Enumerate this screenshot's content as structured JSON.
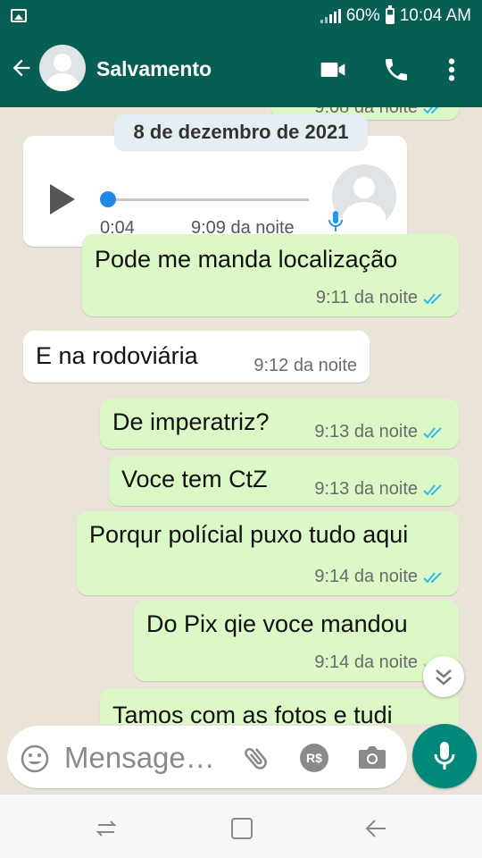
{
  "status_bar": {
    "battery": "60%",
    "time": "10:04 AM"
  },
  "header": {
    "contact_name": "Salvamento"
  },
  "chat": {
    "partial_top_time": "9:08 da noite",
    "date_chip": "8 de dezembro de 2021",
    "audio": {
      "duration": "0:04",
      "time": "9:09 da noite"
    },
    "messages": [
      {
        "text": "Pode me manda localização",
        "time": "9:11 da noite",
        "dir": "out"
      },
      {
        "text": "E na rodoviária",
        "time": "9:12 da noite",
        "dir": "in"
      },
      {
        "text": "De imperatriz?",
        "time": "9:13 da noite",
        "dir": "out"
      },
      {
        "text": "Voce tem CtZ",
        "time": "9:13 da noite",
        "dir": "out"
      },
      {
        "text": "Porqur polícial puxo tudo aqui",
        "time": "9:14 da noite",
        "dir": "out"
      },
      {
        "text": "Do Pix qie voce mandou",
        "time": "9:14 da noite",
        "dir": "out"
      },
      {
        "text": "Tamos com as fotos e tudi",
        "time": "",
        "dir": "out"
      }
    ]
  },
  "composer": {
    "placeholder": "Mensage…",
    "pay_label": "R$"
  },
  "colors": {
    "header": "#075e54",
    "outgoing": "#dcf8c6",
    "incoming": "#ffffff",
    "read_ticks": "#34b7f1",
    "mic_button": "#00897b"
  }
}
